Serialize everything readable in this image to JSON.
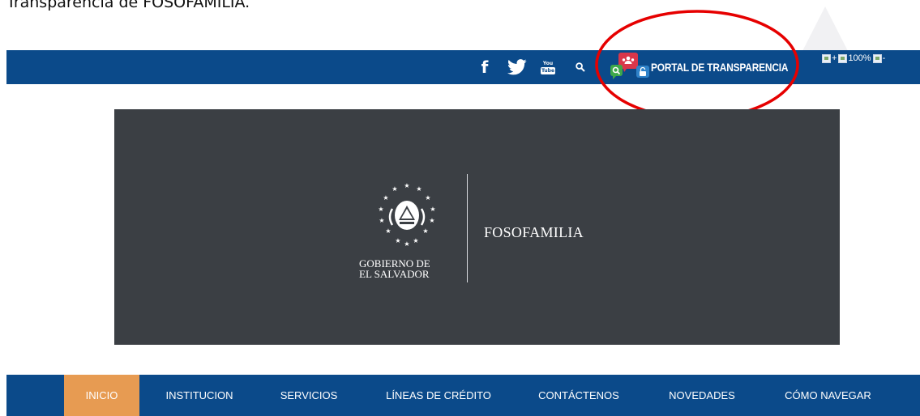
{
  "caption": "Transparencia de FOSOFAMILIA.",
  "topbar": {
    "social": {
      "facebook_glyph": "f",
      "youtube_you": "You",
      "youtube_tube": "Tube"
    },
    "portal": {
      "label": "PORTAL DE TRANSPARENCIA"
    },
    "zoom": {
      "plus": "+",
      "level": "100%",
      "minus": "-"
    }
  },
  "hero": {
    "gov_line1": "GOBIERNO DE",
    "gov_line2": "EL SALVADOR",
    "institution": "FOSOFAMILIA"
  },
  "nav": {
    "items": [
      {
        "label": "INICIO"
      },
      {
        "label": "INSTITUCION"
      },
      {
        "label": "SERVICIOS"
      },
      {
        "label": "LÍNEAS DE CRÉDITO"
      },
      {
        "label": "CONTÁCTENOS"
      },
      {
        "label": "NOVEDADES"
      },
      {
        "label": "CÓMO NAVEGAR"
      }
    ],
    "active": "INICIO"
  },
  "colors": {
    "primary": "#0b4a8a",
    "accent": "#e79b52",
    "hero_bg": "#3b3f44",
    "highlight": "#e60000"
  },
  "icons": [
    "facebook-icon",
    "twitter-icon",
    "youtube-icon",
    "search-icon",
    "transparency-portal-icon",
    "coat-of-arms-icon"
  ]
}
